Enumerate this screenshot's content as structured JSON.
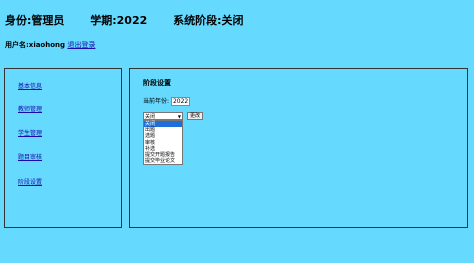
{
  "header": {
    "identity": "身份:管理员",
    "semester": "学期:2022",
    "stage": "系统阶段:关闭"
  },
  "user": {
    "label": "用户名:xiaohong",
    "logout": "退出登录"
  },
  "sidebar": {
    "items": [
      {
        "label": "基本信息"
      },
      {
        "label": "教师管理"
      },
      {
        "label": "学生管理"
      },
      {
        "label": "题目审核"
      },
      {
        "label": "阶段设置"
      }
    ]
  },
  "main": {
    "title": "阶段设置",
    "year_label": "当前年份:",
    "year_value": "2022",
    "select_value": "关闭",
    "change_button": "更改",
    "options": [
      "关闭",
      "出题",
      "选题",
      "审核",
      "补选",
      "提交开题报告",
      "提交毕业论文"
    ],
    "selected_index": 0
  }
}
